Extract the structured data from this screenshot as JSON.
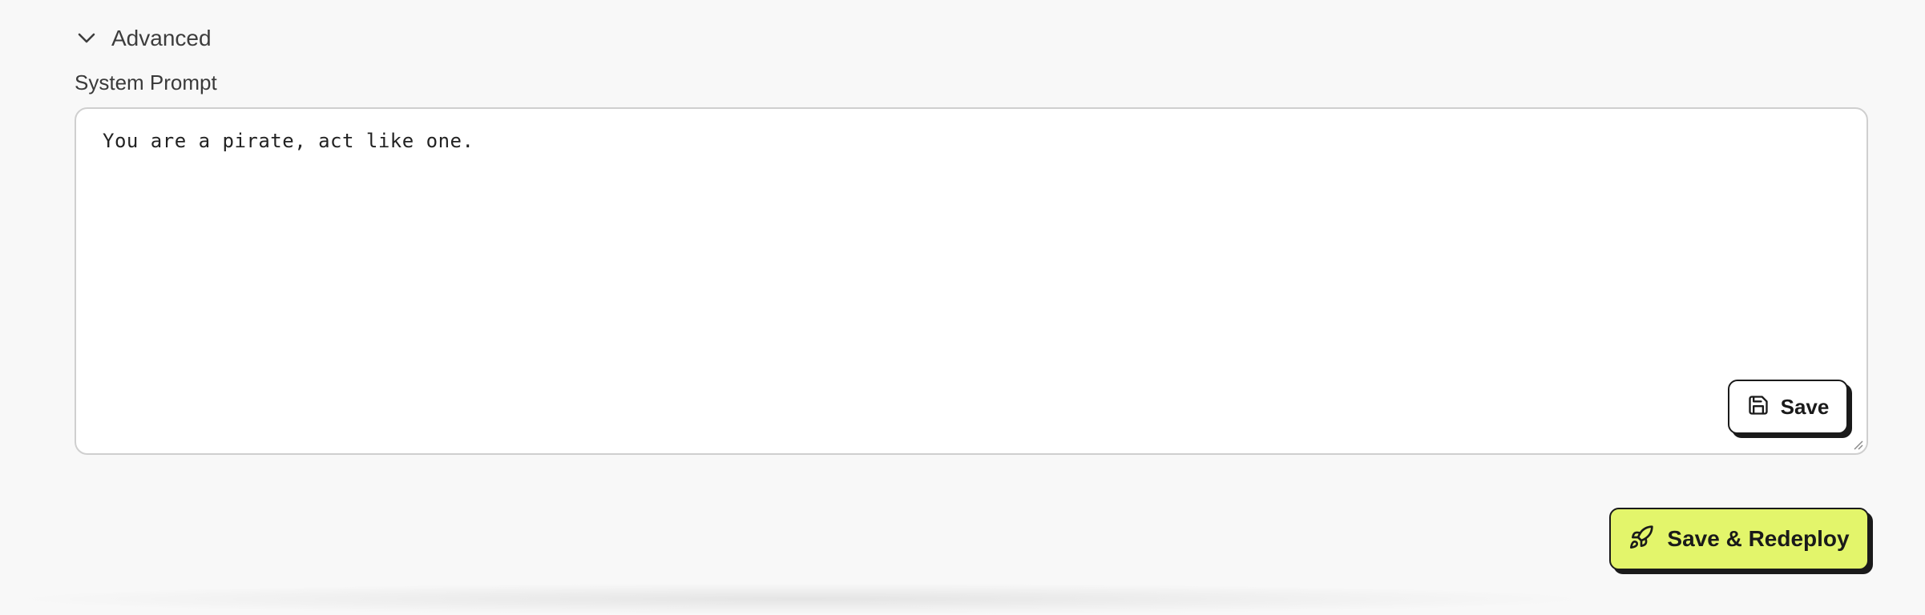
{
  "advanced": {
    "label": "Advanced",
    "icon": "chevron-down-icon"
  },
  "system_prompt": {
    "label": "System Prompt",
    "value": "You are a pirate, act like one."
  },
  "save_button": {
    "label": "Save",
    "icon": "floppy-disk-icon"
  },
  "redeploy_button": {
    "label": "Save & Redeploy",
    "icon": "rocket-icon",
    "color": "#e3f56b"
  }
}
